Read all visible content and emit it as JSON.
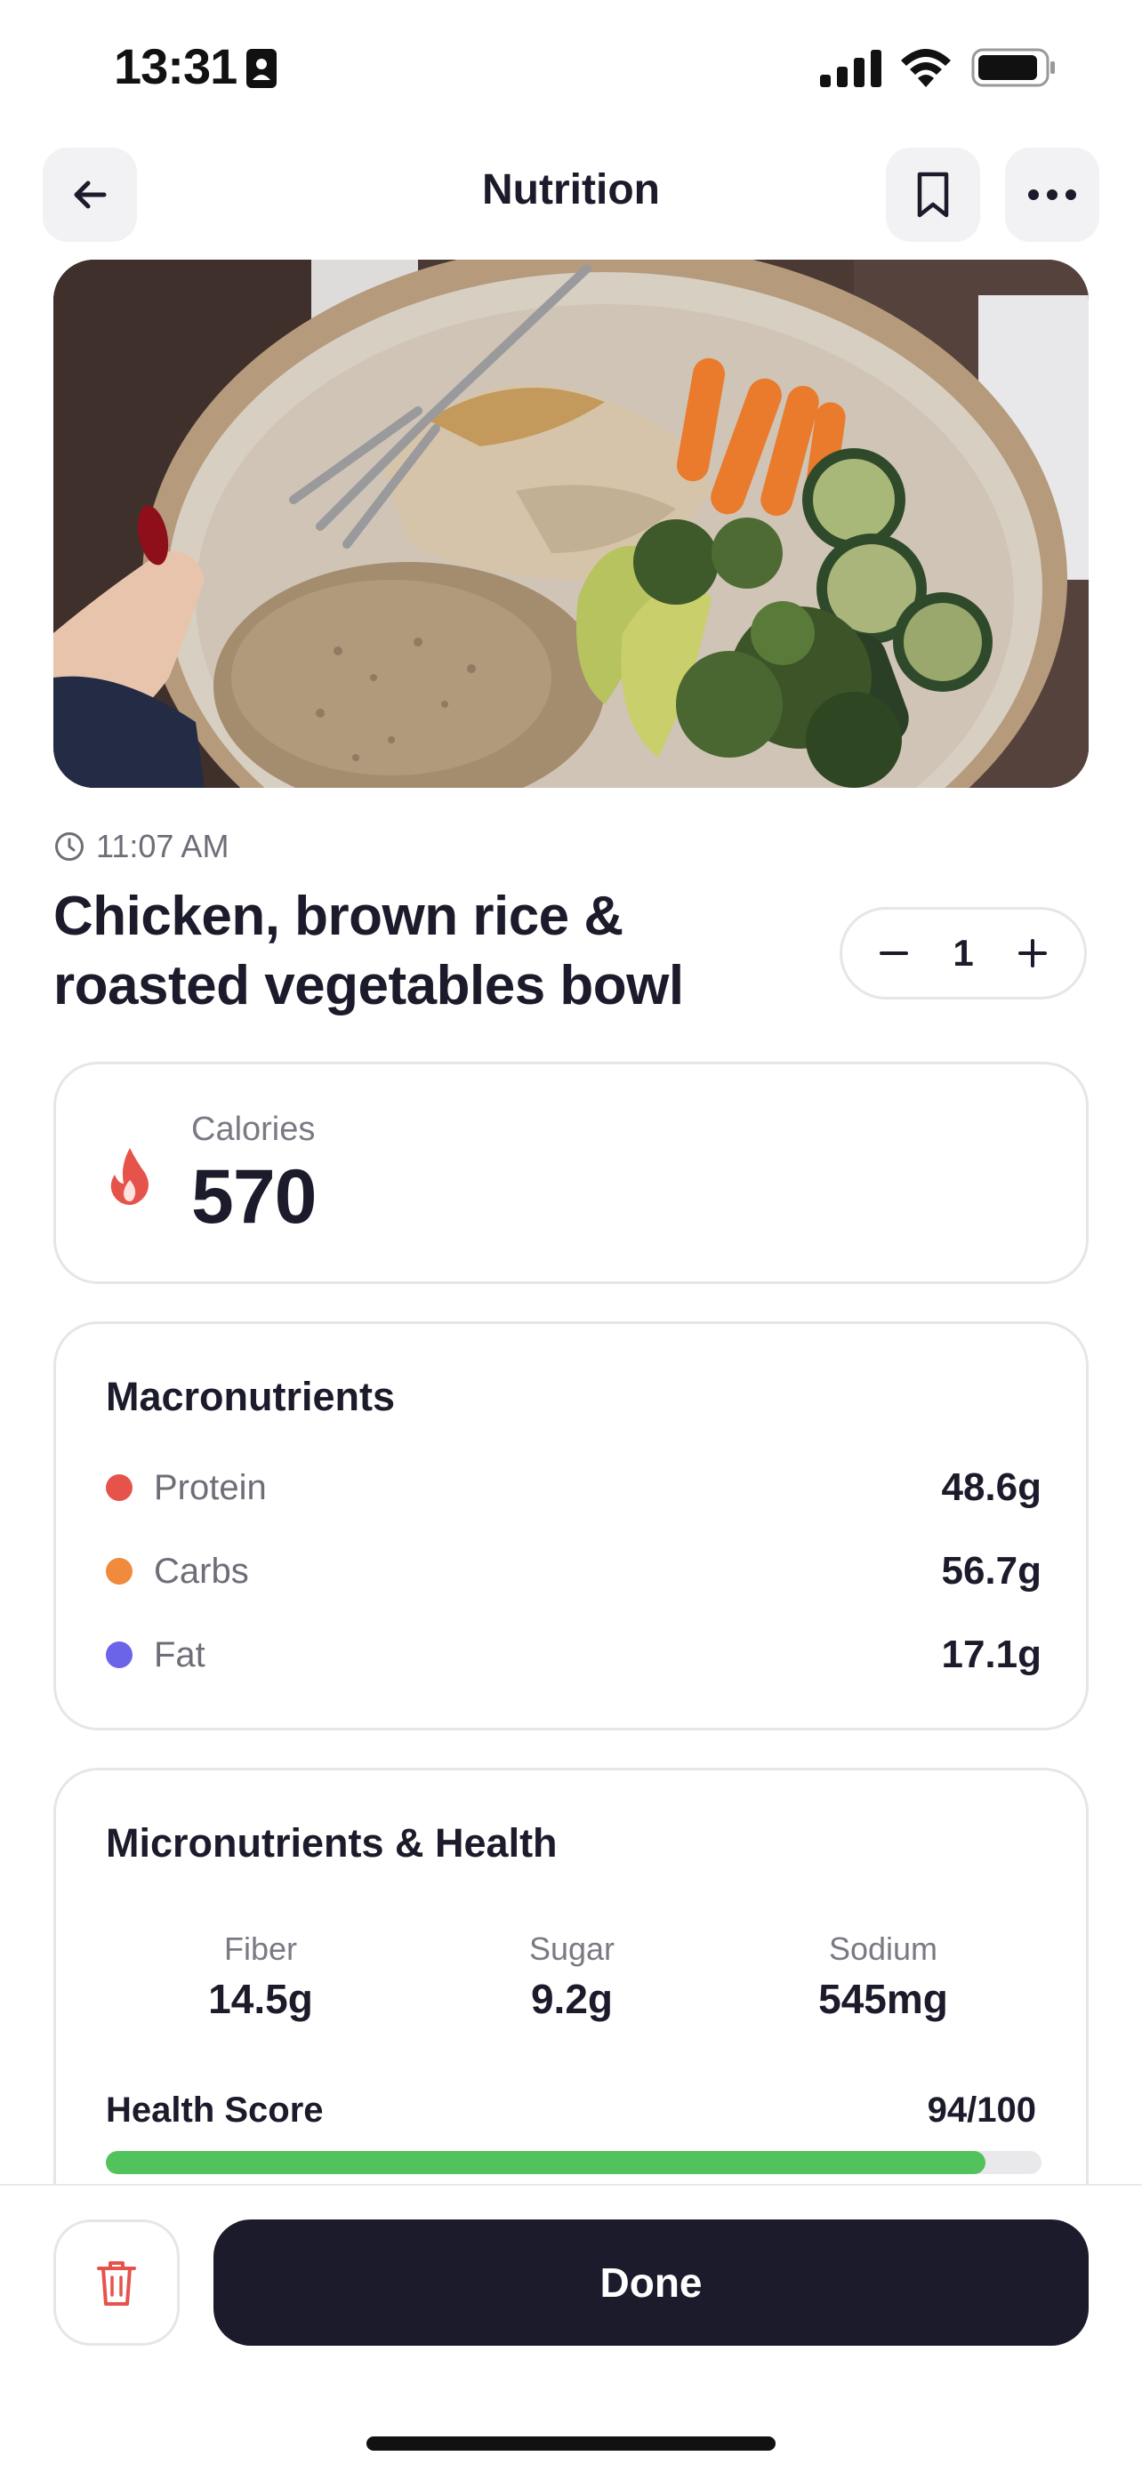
{
  "status_bar": {
    "time": "13:31"
  },
  "nav": {
    "title": "Nutrition",
    "back_icon": "arrow-left-icon",
    "bookmark_icon": "bookmark-icon",
    "more_icon": "ellipsis-icon"
  },
  "meal": {
    "time": "11:07 AM",
    "title": "Chicken, brown rice & roasted vegetables bowl",
    "servings": "1"
  },
  "calories": {
    "label": "Calories",
    "value": "570",
    "icon_color": "#e5534b"
  },
  "macronutrients": {
    "title": "Macronutrients",
    "items": [
      {
        "label": "Protein",
        "value": "48.6g",
        "color": "#e5534b"
      },
      {
        "label": "Carbs",
        "value": "56.7g",
        "color": "#f08a3c"
      },
      {
        "label": "Fat",
        "value": "17.1g",
        "color": "#6b63e8"
      }
    ]
  },
  "micronutrients": {
    "title": "Micronutrients & Health",
    "items": [
      {
        "label": "Fiber",
        "value": "14.5g"
      },
      {
        "label": "Sugar",
        "value": "9.2g"
      },
      {
        "label": "Sodium",
        "value": "545mg"
      }
    ],
    "health_score_label": "Health Score",
    "health_score_text": "94/100",
    "health_score_fraction": 0.94,
    "health_color": "#51c25c"
  },
  "actions": {
    "done_label": "Done",
    "delete_icon": "trash-icon"
  }
}
